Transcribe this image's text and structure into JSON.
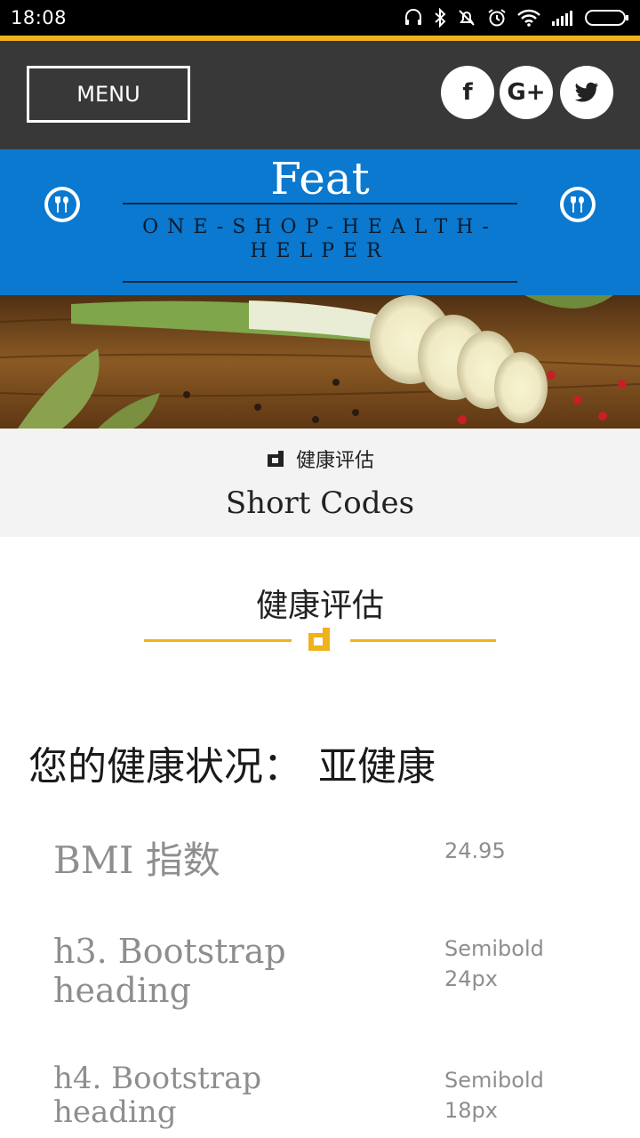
{
  "status_bar": {
    "time": "18:08",
    "icons": [
      "headset-icon",
      "bluetooth-icon",
      "mute-icon",
      "alarm-icon",
      "wifi-icon",
      "signal-icon",
      "battery-icon"
    ]
  },
  "header": {
    "menu_label": "MENU",
    "social": [
      {
        "name": "facebook-icon",
        "glyph": "f"
      },
      {
        "name": "google-plus-icon",
        "glyph": "G+"
      },
      {
        "name": "twitter-icon",
        "glyph": "twitter-bird"
      }
    ]
  },
  "brand": {
    "title": "Feat",
    "tagline": "ONE-SHOP-HEALTH-HELPER",
    "logo_icon": "fork-spoon-icon"
  },
  "breadcrumb": {
    "icon": "corner-mark-icon",
    "text": "健康评估",
    "title": "Short Codes"
  },
  "section": {
    "title": "健康评估",
    "icon": "corner-mark-icon"
  },
  "health": {
    "label": "您的健康状况：",
    "value": "亚健康"
  },
  "rows": [
    {
      "label": "BMI 指数",
      "value": "24.95"
    },
    {
      "label": "h3. Bootstrap heading",
      "value": "Semibold 24px"
    },
    {
      "label": "h4. Bootstrap heading",
      "value": "Semibold 18px"
    }
  ],
  "colors": {
    "accent": "#f0b21a",
    "brand_blue": "#0a79cf",
    "header_dark": "#383838",
    "muted_text": "#8e8e8e"
  }
}
